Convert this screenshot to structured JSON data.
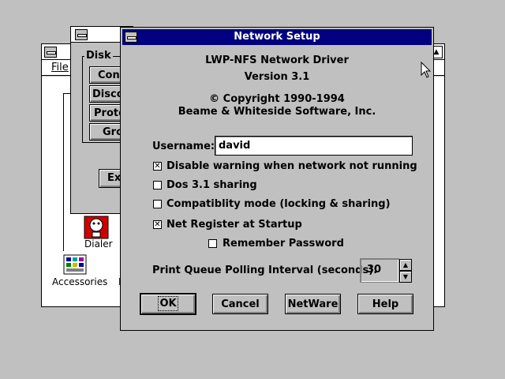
{
  "background_window": {
    "menu_file": "File",
    "icons": [
      {
        "name": "Dialer",
        "label": "Dialer"
      },
      {
        "name": "Accessories",
        "label": "Accessories"
      }
    ],
    "partial_label": "N"
  },
  "disk_window": {
    "group_label": "Disk",
    "buttons": [
      "Conn",
      "Discor",
      "Protec",
      "Grou"
    ],
    "exit_button": "Exi"
  },
  "dialog": {
    "title": "Network Setup",
    "product_name": "LWP-NFS Network Driver",
    "version": "Version 3.1",
    "copyright": "© Copyright 1990-1994",
    "company": "Beame & Whiteside Software, Inc.",
    "username_label": "Username:",
    "username_value": "david",
    "options": [
      {
        "label": "Disable warning when network not running",
        "checked": true
      },
      {
        "label": "Dos 3.1 sharing",
        "checked": false
      },
      {
        "label": "Compatiblity mode (locking & sharing)",
        "checked": false
      },
      {
        "label": "Net Register at Startup",
        "checked": true
      },
      {
        "label": "Remember Password",
        "checked": false
      }
    ],
    "polling_label": "Print Queue Polling Interval (seconds):",
    "polling_value": "30",
    "buttons": {
      "ok": "OK",
      "cancel": "Cancel",
      "netware": "NetWare",
      "help": "Help"
    }
  },
  "colors": {
    "desktop": "#c0c0c0",
    "titlebar_active": "#000080",
    "window_bg": "#c0c0c0"
  },
  "icons": [
    "system-menu-icon",
    "mouse-pointer-icon",
    "dialer-icon",
    "accessories-icon",
    "spin-up-icon",
    "spin-down-icon"
  ]
}
